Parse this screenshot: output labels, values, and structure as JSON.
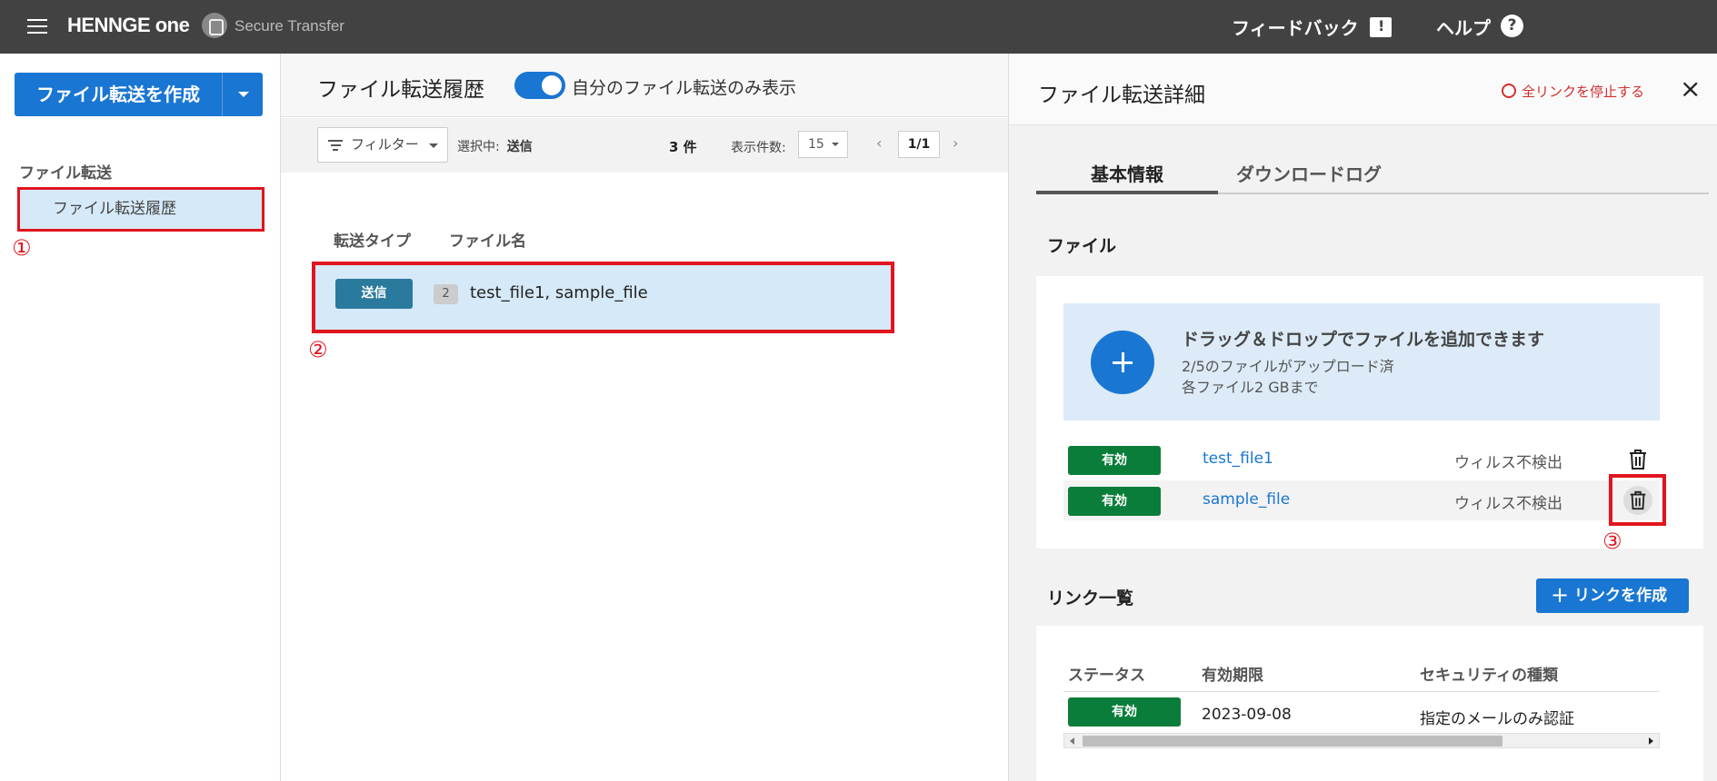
{
  "header": {
    "brand": "HENNGE one",
    "product": "Secure Transfer",
    "feedback_label": "フィードバック",
    "help_label": "ヘルプ",
    "help_icon": "?"
  },
  "sidebar": {
    "create_button_label": "ファイル転送を作成",
    "section_label": "ファイル転送",
    "items": [
      {
        "label": "ファイル転送履歴"
      }
    ]
  },
  "annotations": {
    "one": "①",
    "two": "②",
    "three": "③"
  },
  "history": {
    "title": "ファイル転送履歴",
    "toggle_label": "自分のファイル転送のみ表示",
    "toggle_on": true,
    "filter_label": "フィルター",
    "selected_label": "選択中:",
    "selected_value": "送信",
    "count_label": "3 件",
    "per_page_label": "表示件数:",
    "per_page_value": "15",
    "page_indicator": "1/1",
    "columns": [
      "転送タイプ",
      "ファイル名"
    ],
    "rows": [
      {
        "type": "送信",
        "file_count": "2",
        "file_names": "test_file1, sample_file"
      }
    ]
  },
  "detail": {
    "title": "ファイル転送詳細",
    "stop_all_label": "全リンクを停止する",
    "close_icon": "×",
    "tabs": [
      "基本情報",
      "ダウンロードログ"
    ],
    "files_section_label": "ファイル",
    "dropzone": {
      "title": "ドラッグ＆ドロップでファイルを追加できます",
      "uploaded": "2/5のファイルがアップロード済",
      "limit": "各ファイル2 GBまで"
    },
    "files": [
      {
        "status": "有効",
        "name": "test_file1",
        "virus": "ウィルス不検出"
      },
      {
        "status": "有効",
        "name": "sample_file",
        "virus": "ウィルス不検出"
      }
    ],
    "links_section_label": "リンク一覧",
    "create_link_label": "リンクを作成",
    "link_columns": [
      "ステータス",
      "有効期限",
      "セキュリティの種類"
    ],
    "links": [
      {
        "status": "有効",
        "expiry": "2023-09-08",
        "security": "指定のメールのみ認証"
      }
    ]
  },
  "colors": {
    "accent": "#1976d2",
    "valid": "#0a7d3b",
    "highlight": "#e0151f",
    "topbar": "#424242"
  }
}
